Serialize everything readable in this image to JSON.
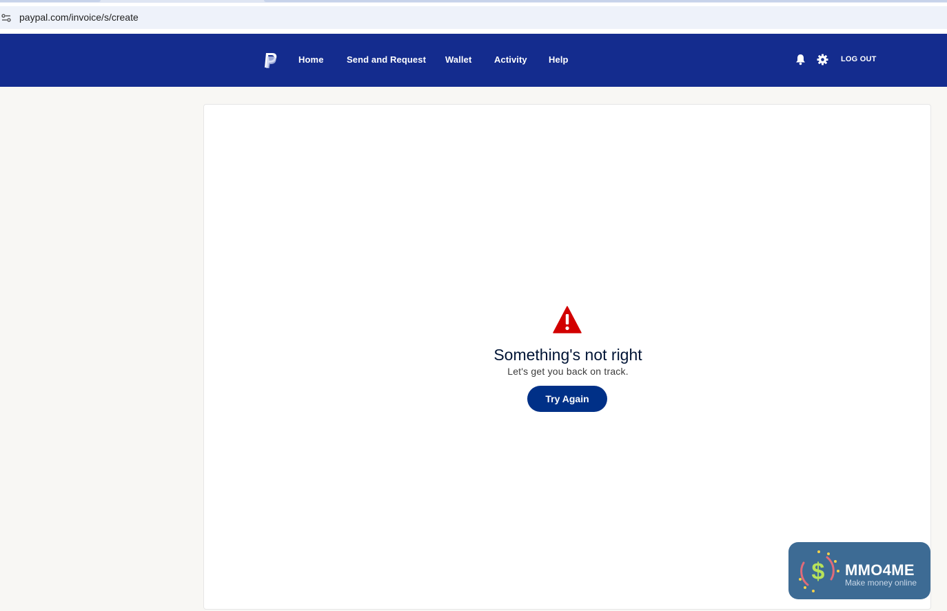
{
  "browser": {
    "url": "paypal.com/invoice/s/create",
    "site_info_icon": "site-settings-icon"
  },
  "header": {
    "brand_icon": "paypal-logo-icon",
    "nav": [
      {
        "label": "Home"
      },
      {
        "label": "Send and Request"
      },
      {
        "label": "Wallet"
      },
      {
        "label": "Activity"
      },
      {
        "label": "Help"
      }
    ],
    "notifications_icon": "bell-icon",
    "settings_icon": "gear-icon",
    "logout_label": "LOG OUT",
    "background_color": "#142c8e"
  },
  "error": {
    "icon": "warning-triangle-icon",
    "title": "Something's not right",
    "subtitle": "Let's get you back on track.",
    "button_label": "Try Again",
    "icon_color": "#d20000",
    "button_color": "#003087"
  },
  "watermark": {
    "title": "MMO4ME",
    "subtitle": "Make money online"
  }
}
